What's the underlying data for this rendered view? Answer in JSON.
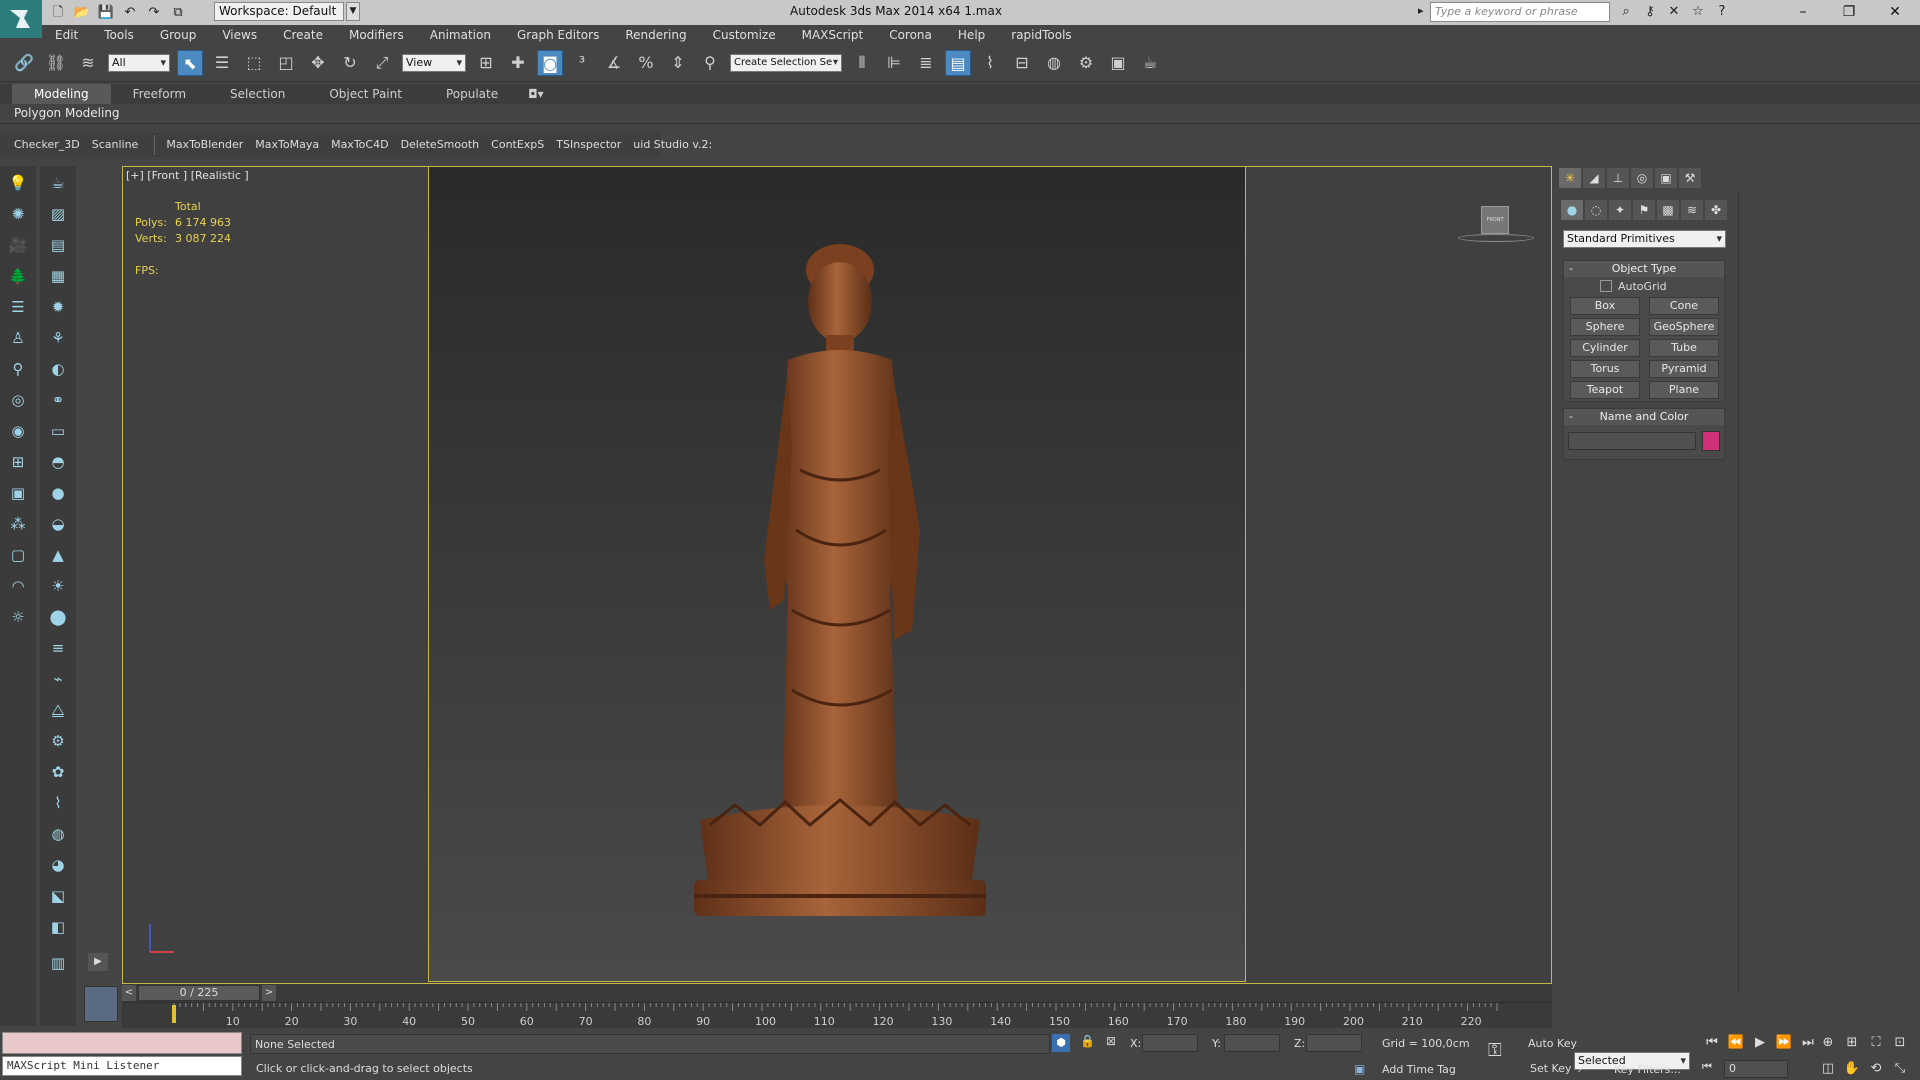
{
  "titlebar": {
    "workspace": "Workspace: Default",
    "title": "Autodesk 3ds Max  2014 x64      1.max",
    "search_placeholder": "Type a keyword or phrase"
  },
  "menu": [
    "Edit",
    "Tools",
    "Group",
    "Views",
    "Create",
    "Modifiers",
    "Animation",
    "Graph Editors",
    "Rendering",
    "Customize",
    "MAXScript",
    "Corona",
    "Help",
    "rapidTools"
  ],
  "toolbar": {
    "selection_filter": "All",
    "ref_coord": "View",
    "named_selection": "Create Selection Se"
  },
  "ribbon": {
    "tabs": [
      "Modeling",
      "Freeform",
      "Selection",
      "Object Paint",
      "Populate"
    ],
    "active_tab": "Modeling",
    "sub_label": "Polygon Modeling"
  },
  "scripts": [
    "Checker_3D",
    "Scanline",
    "MaxToBlender",
    "MaxToMaya",
    "MaxToC4D",
    "DeleteSmooth",
    "ContExpS",
    "TSInspector",
    "uid Studio v.2:"
  ],
  "viewport": {
    "label": "[+] [Front ] [Realistic ]",
    "stats_header": "Total",
    "polys_label": "Polys:",
    "polys_value": "6 174 963",
    "verts_label": "Verts:",
    "verts_value": "3 087 224",
    "fps_label": "FPS:",
    "viewcube_label": "FRONT"
  },
  "command_panel": {
    "category": "Standard Primitives",
    "object_type_title": "Object Type",
    "autogrid": "AutoGrid",
    "buttons": [
      "Box",
      "Cone",
      "Sphere",
      "GeoSphere",
      "Cylinder",
      "Tube",
      "Torus",
      "Pyramid",
      "Teapot",
      "Plane"
    ],
    "name_color_title": "Name and Color",
    "object_color": "#d0307a"
  },
  "timeline": {
    "frame": "0 / 225",
    "ticks": [
      "10",
      "20",
      "30",
      "40",
      "50",
      "60",
      "70",
      "80",
      "90",
      "100",
      "110",
      "120",
      "130",
      "140",
      "150",
      "160",
      "170",
      "180",
      "190",
      "200",
      "210",
      "220"
    ]
  },
  "status": {
    "listener": "MAXScript Mini Listener",
    "selection": "None Selected",
    "prompt": "Click or click-and-drag to select objects",
    "x_label": "X:",
    "y_label": "Y:",
    "z_label": "Z:",
    "grid": "Grid = 100,0cm",
    "add_time_tag": "Add Time Tag",
    "auto_key": "Auto Key",
    "set_key": "Set Key",
    "key_mode": "Selected",
    "key_filters": "Key Filters...",
    "current_frame": "0"
  },
  "colors": {
    "viewport_border": "#c8b845",
    "stats_text": "#e6d34a",
    "statue": "#8a4c2a"
  }
}
